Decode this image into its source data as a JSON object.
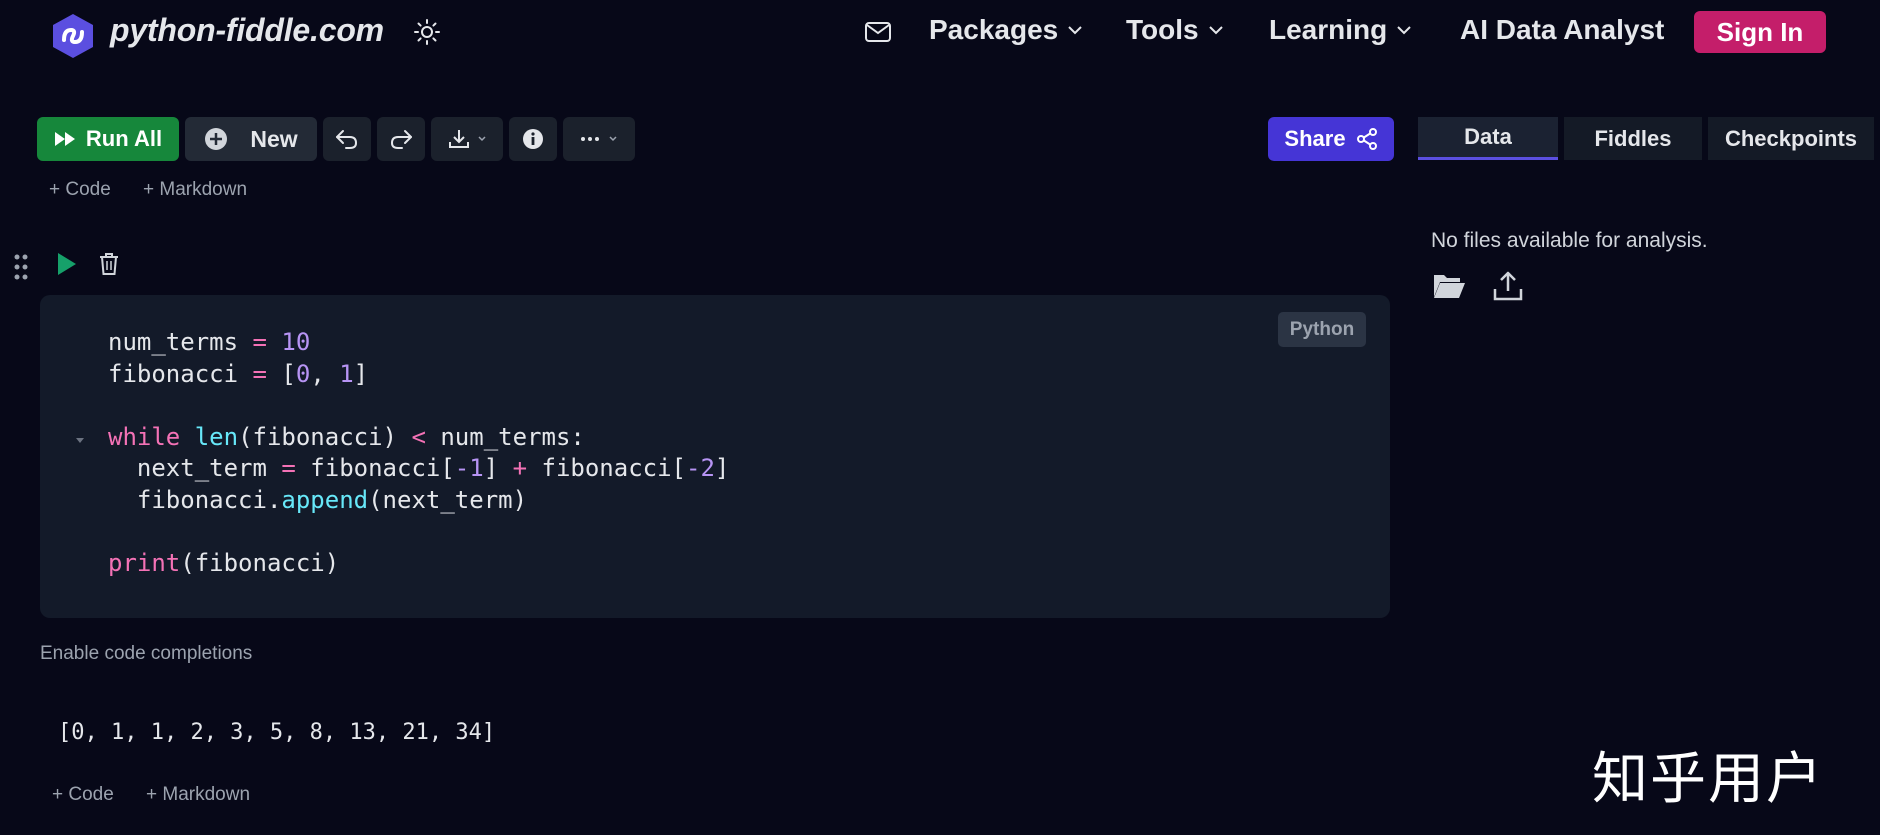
{
  "header": {
    "brand": "python-fiddle.com",
    "nav": [
      {
        "label": "Packages",
        "icon": "chevron-down-icon"
      },
      {
        "label": "Tools",
        "icon": "chevron-down-icon"
      },
      {
        "label": "Learning",
        "icon": "chevron-down-icon"
      }
    ],
    "ai_link": "AI Data Analyst",
    "sign_in": "Sign In"
  },
  "toolbar": {
    "run_all": "Run All",
    "new": "New",
    "share": "Share",
    "icons": [
      "undo-icon",
      "redo-icon",
      "download-icon",
      "info-icon",
      "more-icon"
    ]
  },
  "right_panel": {
    "tabs": [
      {
        "label": "Data",
        "active": true
      },
      {
        "label": "Fiddles",
        "active": false
      },
      {
        "label": "Checkpoints",
        "active": false
      }
    ],
    "empty_message": "No files available for analysis."
  },
  "cell": {
    "add_code": "+ Code",
    "add_markdown": "+ Markdown",
    "language": "Python",
    "code_lines": [
      "num_terms = 10",
      "fibonacci = [0, 1]",
      "",
      "while len(fibonacci) < num_terms:",
      "  next_term = fibonacci[-1] + fibonacci[-2]",
      "  fibonacci.append(next_term)",
      "",
      "print(fibonacci)"
    ],
    "enable_completions": "Enable code completions",
    "output": "[0, 1, 1, 2, 3, 5, 8, 13, 21, 34]"
  },
  "footer": {
    "add_code": "+ Code",
    "add_markdown": "+ Markdown"
  },
  "watermark": "知乎用户",
  "colors": {
    "background": "#070818",
    "run_green": "#16873b",
    "share_purple": "#4535d6",
    "signin_pink": "#c41e6a"
  }
}
